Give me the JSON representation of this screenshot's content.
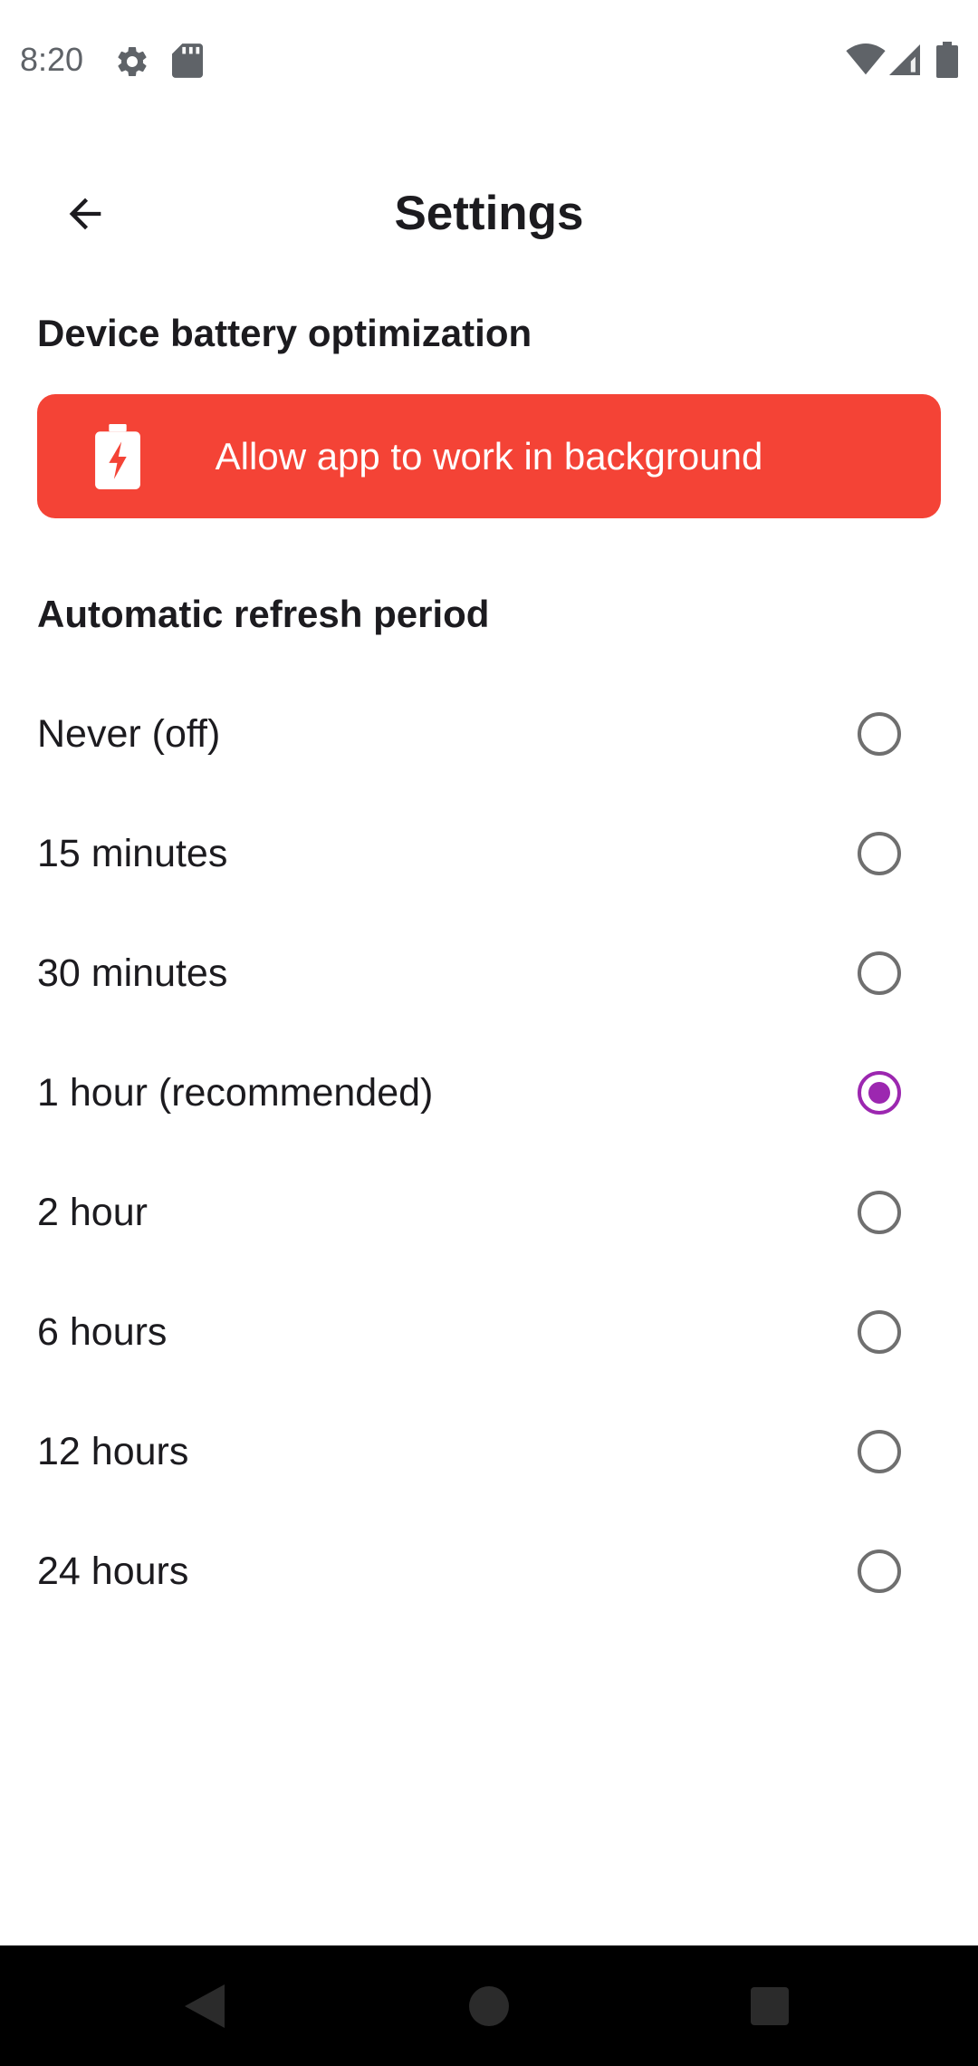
{
  "status_bar": {
    "time": "8:20",
    "left_icons": [
      "gear-icon",
      "sd-card-icon"
    ],
    "right_icons": [
      "wifi-icon",
      "cell-signal-icon",
      "battery-icon"
    ]
  },
  "app_bar": {
    "title": "Settings",
    "back_icon": "arrow-back-icon"
  },
  "battery_section": {
    "heading": "Device battery optimization",
    "button_label": "Allow app to work in background",
    "button_icon": "battery-charging-icon",
    "button_color": "#f44336"
  },
  "refresh_section": {
    "heading": "Automatic refresh period",
    "selected_color": "#9c27b0",
    "options": [
      {
        "label": "Never (off)",
        "selected": false
      },
      {
        "label": "15 minutes",
        "selected": false
      },
      {
        "label": "30 minutes",
        "selected": false
      },
      {
        "label": "1 hour (recommended)",
        "selected": true
      },
      {
        "label": "2 hour",
        "selected": false
      },
      {
        "label": "6 hours",
        "selected": false
      },
      {
        "label": "12 hours",
        "selected": false
      },
      {
        "label": "24 hours",
        "selected": false
      }
    ]
  },
  "nav_bar": {
    "buttons": [
      "back-triangle-icon",
      "home-circle-icon",
      "recents-square-icon"
    ]
  }
}
